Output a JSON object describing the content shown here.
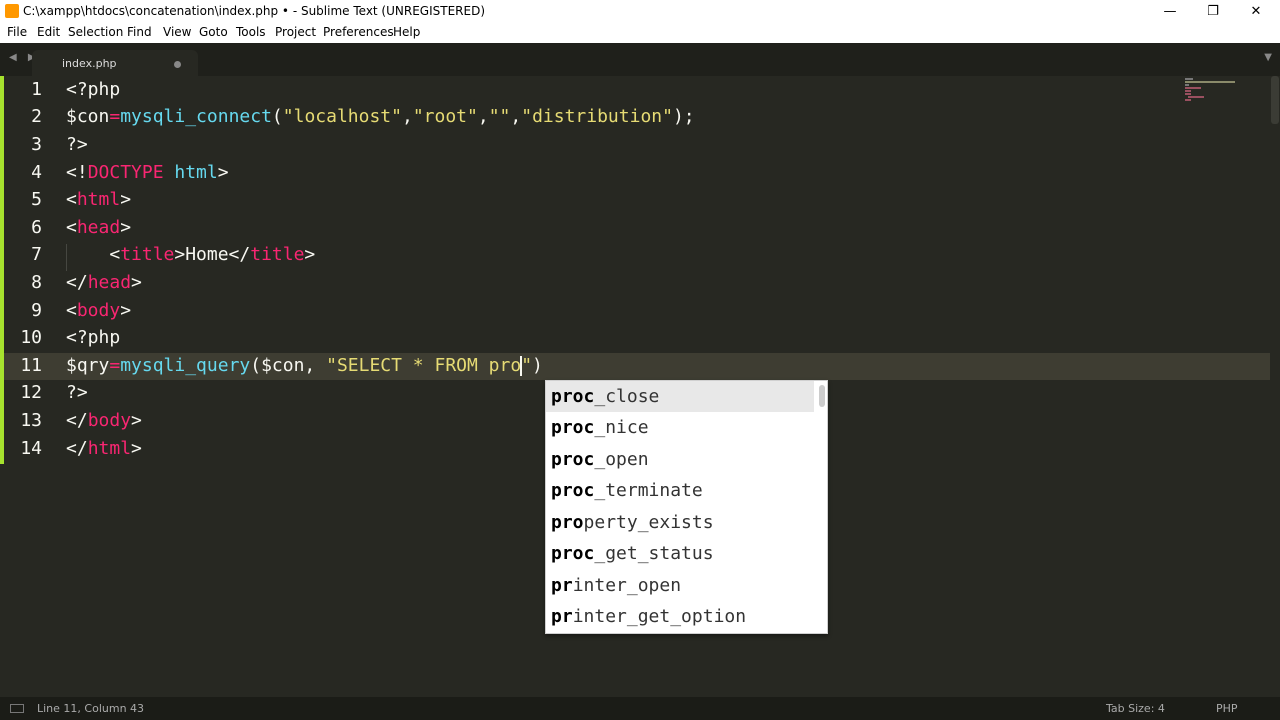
{
  "window": {
    "title": "C:\\xampp\\htdocs\\concatenation\\index.php • - Sublime Text (UNREGISTERED)",
    "minimize": "—",
    "restore": "❐",
    "close": "✕"
  },
  "menu": [
    "File",
    "Edit",
    "Selection",
    "Find",
    "View",
    "Goto",
    "Tools",
    "Project",
    "Preferences",
    "Help"
  ],
  "tab": {
    "label": "index.php"
  },
  "line_numbers": [
    "1",
    "2",
    "3",
    "4",
    "5",
    "6",
    "7",
    "8",
    "9",
    "10",
    "11",
    "12",
    "13",
    "14"
  ],
  "code": {
    "l1": "<?php",
    "l2_var": "$con",
    "l2_eq": "=",
    "l2_fn": "mysqli_connect",
    "l2_open": "(",
    "l2_s1": "\"localhost\"",
    "l2_c1": ",",
    "l2_s2": "\"root\"",
    "l2_c2": ",",
    "l2_s3": "\"\"",
    "l2_c3": ",",
    "l2_s4": "\"distribution\"",
    "l2_close": ");",
    "l3": "?>",
    "l4_a": "<!",
    "l4_b": "DOCTYPE",
    "l4_c": " html",
    "l4_d": ">",
    "l5_a": "<",
    "l5_b": "html",
    "l5_c": ">",
    "l6_a": "<",
    "l6_b": "head",
    "l6_c": ">",
    "l7_a": "    <",
    "l7_b": "title",
    "l7_c": ">Home</",
    "l7_d": "title",
    "l7_e": ">",
    "l8_a": "</",
    "l8_b": "head",
    "l8_c": ">",
    "l9_a": "<",
    "l9_b": "body",
    "l9_c": ">",
    "l10": "<?php",
    "l11_var": "$qry",
    "l11_eq": "=",
    "l11_fn": "mysqli_query",
    "l11_open": "($con, ",
    "l11_str": "\"SELECT * FROM pro",
    "l11_str_end": "\"",
    "l11_close": ")",
    "l12": "?>",
    "l13_a": "</",
    "l13_b": "body",
    "l13_c": ">",
    "l14_a": "</",
    "l14_b": "html",
    "l14_c": ">"
  },
  "autocomplete": [
    {
      "match": "proc",
      "rest": "_close"
    },
    {
      "match": "proc",
      "rest": "_nice"
    },
    {
      "match": "proc",
      "rest": "_open"
    },
    {
      "match": "proc",
      "rest": "_terminate"
    },
    {
      "match": "pro",
      "rest": "perty_exists"
    },
    {
      "match": "proc",
      "rest": "_get_status"
    },
    {
      "match": "pr",
      "rest": "inter_open"
    },
    {
      "match": "pr",
      "rest": "inter_get_option"
    }
  ],
  "status": {
    "position": "Line 11, Column 43",
    "tab_size": "Tab Size: 4",
    "syntax": "PHP"
  }
}
